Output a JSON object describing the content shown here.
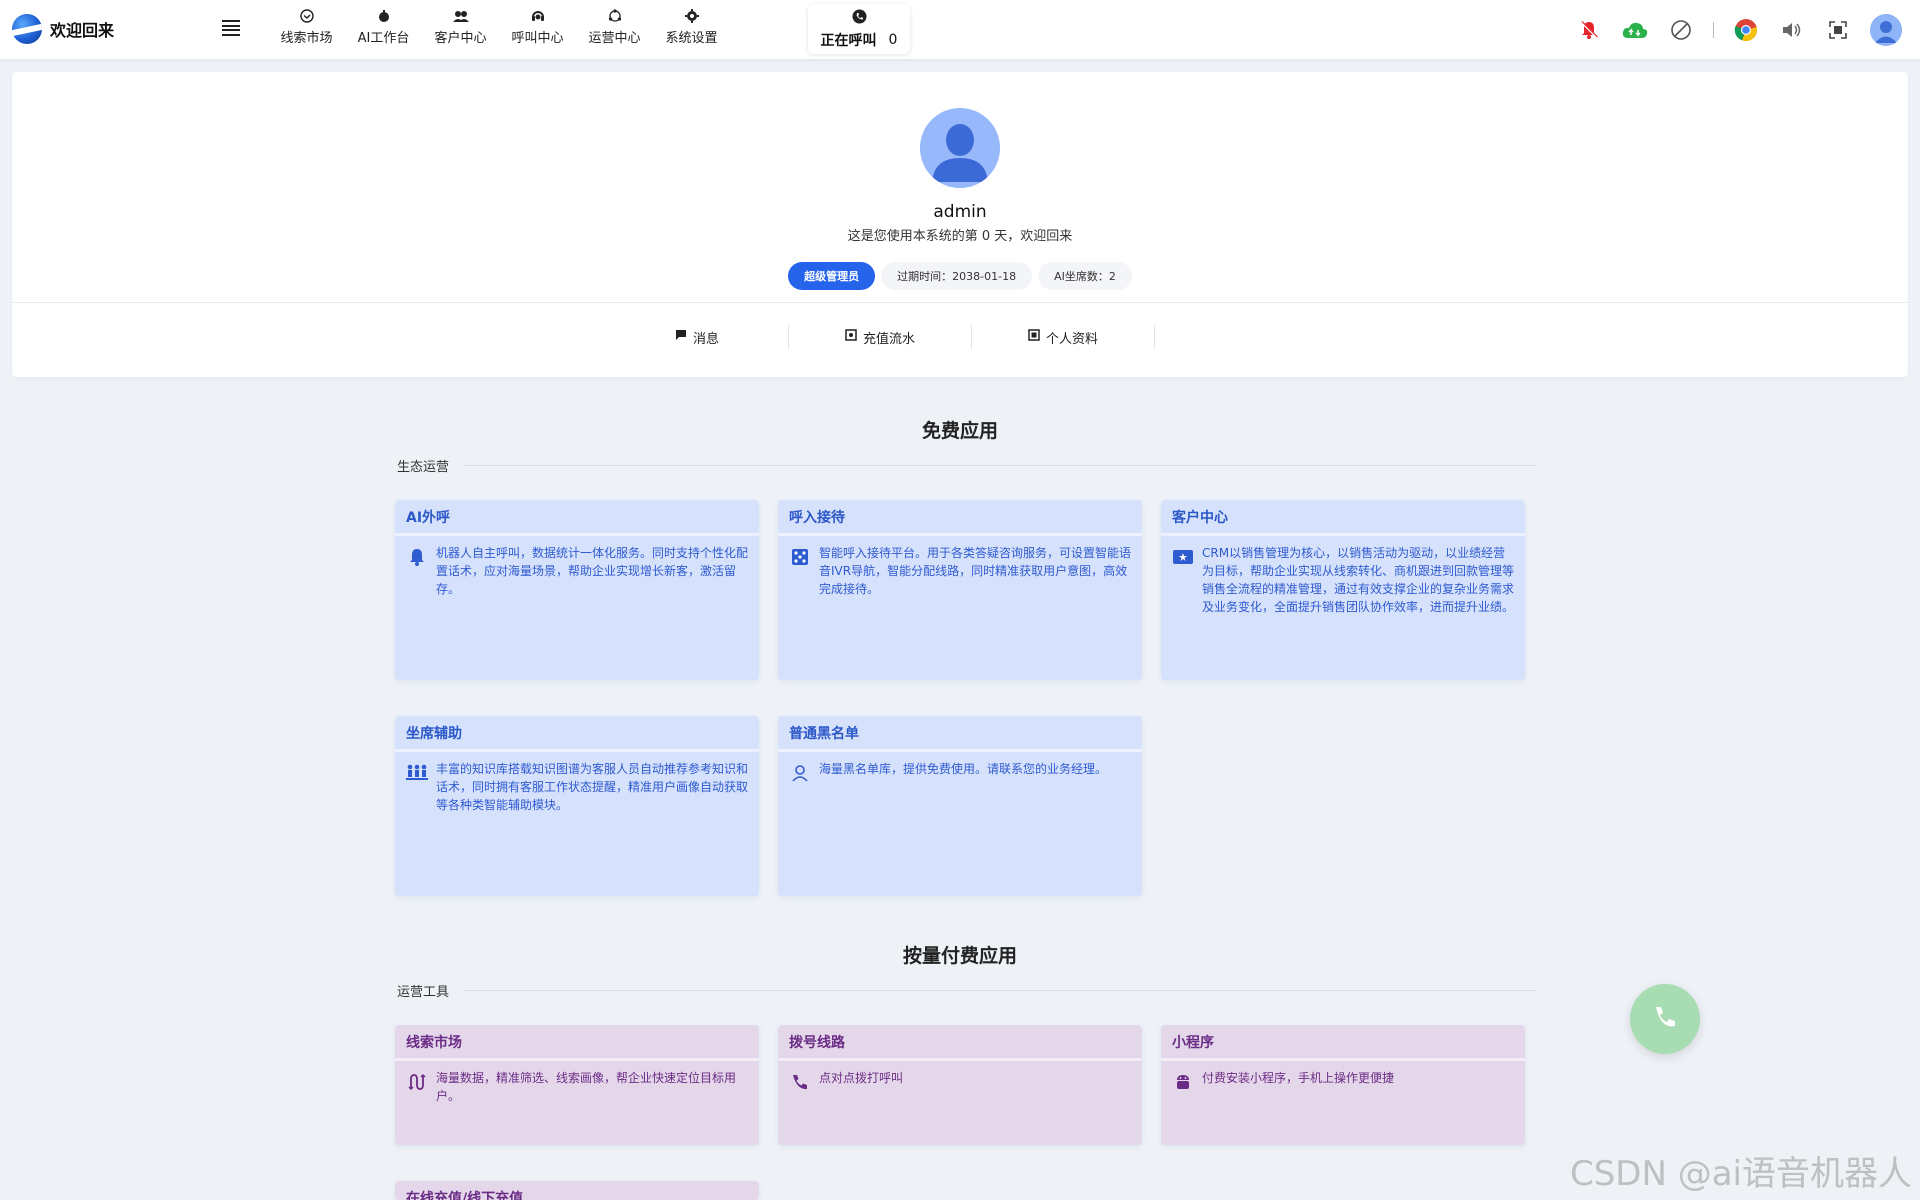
{
  "header": {
    "brand_title": "欢迎回来",
    "nav": [
      {
        "label": "线索市场",
        "icon": "clue-market-icon"
      },
      {
        "label": "AI工作台",
        "icon": "ai-workbench-icon"
      },
      {
        "label": "客户中心",
        "icon": "customer-center-icon"
      },
      {
        "label": "呼叫中心",
        "icon": "call-center-icon"
      },
      {
        "label": "运营中心",
        "icon": "operation-center-icon"
      },
      {
        "label": "系统设置",
        "icon": "settings-icon"
      }
    ],
    "calling": {
      "label": "正在呼叫",
      "count": "0"
    }
  },
  "profile": {
    "username": "admin",
    "welcome": "这是您使用本系统的第 0 天，欢迎回来",
    "tags": [
      "超级管理员",
      "过期时间：2038-01-18",
      "AI坐席数：2"
    ],
    "tabs": [
      {
        "label": "消息",
        "icon": "message-icon"
      },
      {
        "label": "充值流水",
        "icon": "recharge-icon"
      },
      {
        "label": "个人资料",
        "icon": "profile-icon"
      }
    ]
  },
  "free_apps": {
    "title": "免费应用",
    "group": "生态运营",
    "cards": [
      {
        "title": "AI外呼",
        "icon": "bell-icon",
        "desc": "机器人自主呼叫，数据统计一体化服务。同时支持个性化配置话术，应对海量场景，帮助企业实现增长新客，激活留存。"
      },
      {
        "title": "呼入接待",
        "icon": "dice-icon",
        "desc": "智能呼入接待平台。用于各类答疑咨询服务，可设置智能语音IVR导航，智能分配线路，同时精准获取用户意图，高效完成接待。"
      },
      {
        "title": "客户中心",
        "icon": "id-card-icon",
        "desc": "CRM以销售管理为核心，以销售活动为驱动，以业绩经营为目标，帮助企业实现从线索转化、商机跟进到回款管理等销售全流程的精准管理，通过有效支撑企业的复杂业务需求及业务变化，全面提升销售团队协作效率，进而提升业绩。"
      },
      {
        "title": "坐席辅助",
        "icon": "seats-icon",
        "desc": "丰富的知识库搭载知识图谱为客服人员自动推荐参考知识和话术，同时拥有客服工作状态提醒，精准用户画像自动获取等各种类智能辅助模块。"
      },
      {
        "title": "普通黑名单",
        "icon": "user-icon",
        "desc": "海量黑名单库，提供免费使用。请联系您的业务经理。"
      }
    ]
  },
  "paid_apps": {
    "title": "按量付费应用",
    "group": "运营工具",
    "cards": [
      {
        "title": "线索市场",
        "icon": "route-icon",
        "desc": "海量数据，精准筛选、线索画像，帮企业快速定位目标用户。"
      },
      {
        "title": "拨号线路",
        "icon": "phone-icon",
        "desc": "点对点拨打呼叫"
      },
      {
        "title": "小程序",
        "icon": "android-icon",
        "desc": "付费安装小程序，手机上操作更便捷"
      },
      {
        "title": "在线充值/线下充值",
        "icon": "",
        "desc": ""
      }
    ]
  },
  "watermark": "CSDN @ai语音机器人",
  "colors": {
    "primary": "#2563eb",
    "blue_card": "#d6e1fb",
    "purple_card": "#e5d7ea",
    "fab": "#a8dcb2"
  }
}
